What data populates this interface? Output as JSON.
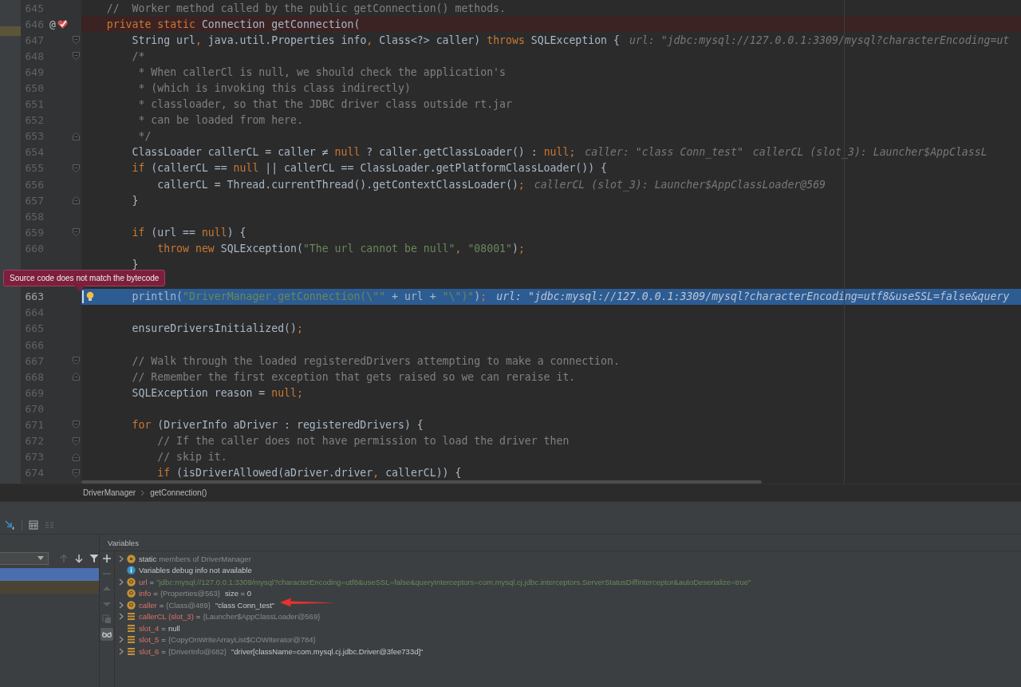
{
  "editor": {
    "lines": [
      {
        "number": "645",
        "kind": "plain",
        "selected": false,
        "breakpoint": false,
        "text": "    //  Worker method called by the public getConnection() methods."
      },
      {
        "number": "646",
        "kind": "plain",
        "selected": false,
        "breakpoint": true,
        "gutter_text": "@",
        "text": "    private static Connection getConnection("
      },
      {
        "number": "647",
        "kind": "fold_start",
        "selected": false,
        "breakpoint": false,
        "text": "        String url, java.util.Properties info, Class<?> caller) throws SQLException {",
        "hints": [
          "url: \"jdbc:mysql://127.0.0.1:3309/mysql?characterEncoding=ut"
        ]
      },
      {
        "number": "648",
        "kind": "fold_start",
        "selected": false,
        "breakpoint": false,
        "text": "        /*"
      },
      {
        "number": "649",
        "kind": "plain",
        "selected": false,
        "breakpoint": false,
        "text": "         * When callerCl is null, we should check the application's"
      },
      {
        "number": "650",
        "kind": "plain",
        "selected": false,
        "breakpoint": false,
        "text": "         * (which is invoking this class indirectly)"
      },
      {
        "number": "651",
        "kind": "plain",
        "selected": false,
        "breakpoint": false,
        "text": "         * classloader, so that the JDBC driver class outside rt.jar"
      },
      {
        "number": "652",
        "kind": "plain",
        "selected": false,
        "breakpoint": false,
        "text": "         * can be loaded from here."
      },
      {
        "number": "653",
        "kind": "fold_end",
        "selected": false,
        "breakpoint": false,
        "text": "         */"
      },
      {
        "number": "654",
        "kind": "plain",
        "selected": false,
        "breakpoint": false,
        "text": "        ClassLoader callerCL = caller ≠ null ? caller.getClassLoader() : null;",
        "hints": [
          "caller: \"class Conn_test\"",
          "callerCL (slot_3): Launcher$AppClassL"
        ]
      },
      {
        "number": "655",
        "kind": "fold_start",
        "selected": false,
        "breakpoint": false,
        "text": "        if (callerCL == null || callerCL == ClassLoader.getPlatformClassLoader()) {"
      },
      {
        "number": "656",
        "kind": "plain",
        "selected": false,
        "breakpoint": false,
        "text": "            callerCL = Thread.currentThread().getContextClassLoader();",
        "hints": [
          "callerCL (slot_3): Launcher$AppClassLoader@569"
        ]
      },
      {
        "number": "657",
        "kind": "fold_end",
        "selected": false,
        "breakpoint": false,
        "text": "        }"
      },
      {
        "number": "658",
        "kind": "plain",
        "selected": false,
        "breakpoint": false
      },
      {
        "number": "659",
        "kind": "fold_start",
        "selected": false,
        "breakpoint": false,
        "text": "        if (url == null) {"
      },
      {
        "number": "660",
        "kind": "plain",
        "selected": false,
        "breakpoint": false,
        "text": "            throw new SQLException(\"The url cannot be null\", \"08001\");"
      },
      {
        "kind": "plain",
        "selected": false,
        "breakpoint": false,
        "text": "        }"
      },
      {
        "kind": "plain",
        "selected": false,
        "breakpoint": false
      },
      {
        "number": "663",
        "kind": "plain",
        "selected": true,
        "breakpoint": false,
        "text": "        println(\"DriverManager.getConnection(\\\"\" + url + \"\\\")\");",
        "hints": [
          "url: \"jdbc:mysql://127.0.0.1:3309/mysql?characterEncoding=utf8&useSSL=false&query"
        ]
      },
      {
        "number": "664",
        "kind": "plain",
        "selected": false,
        "breakpoint": false
      },
      {
        "number": "665",
        "kind": "plain",
        "selected": false,
        "breakpoint": false,
        "text": "        ensureDriversInitialized();"
      },
      {
        "number": "666",
        "kind": "plain",
        "selected": false,
        "breakpoint": false
      },
      {
        "number": "667",
        "kind": "fold_start",
        "selected": false,
        "breakpoint": false,
        "text": "        // Walk through the loaded registeredDrivers attempting to make a connection."
      },
      {
        "number": "668",
        "kind": "fold_end",
        "selected": false,
        "breakpoint": false,
        "text": "        // Remember the first exception that gets raised so we can reraise it."
      },
      {
        "number": "669",
        "kind": "plain",
        "selected": false,
        "breakpoint": false,
        "text": "        SQLException reason = null;"
      },
      {
        "number": "670",
        "kind": "plain",
        "selected": false,
        "breakpoint": false
      },
      {
        "number": "671",
        "kind": "fold_start",
        "selected": false,
        "breakpoint": false,
        "text": "        for (DriverInfo aDriver : registeredDrivers) {"
      },
      {
        "number": "672",
        "kind": "fold_start",
        "selected": false,
        "breakpoint": false,
        "text": "            // If the caller does not have permission to load the driver then"
      },
      {
        "number": "673",
        "kind": "fold_end",
        "selected": false,
        "breakpoint": false,
        "text": "            // skip it."
      },
      {
        "number": "674",
        "kind": "fold_start",
        "selected": false,
        "breakpoint": false,
        "text": "            if (isDriverAllowed(aDriver.driver, callerCL)) {"
      }
    ],
    "tooltip": {
      "text": "Source code does not match the bytecode"
    },
    "breadcrumb": [
      "DriverManager",
      "getConnection()"
    ]
  },
  "debugger": {
    "frame_tools": [
      {
        "kind": "up",
        "disabled": true
      },
      {
        "kind": "down",
        "disabled": false
      },
      {
        "kind": "filter",
        "disabled": false
      }
    ],
    "frames": [
      {
        "selected": true,
        "kind": "frame"
      },
      {
        "selected": false,
        "kind": "library"
      }
    ],
    "variables_title": "Variables",
    "side_tools": [
      {
        "kind": "add",
        "disabled": false,
        "on": false
      },
      {
        "kind": "remove",
        "disabled": true,
        "on": false
      },
      {
        "kind": "up",
        "disabled": true,
        "on": false
      },
      {
        "kind": "down",
        "disabled": true,
        "on": false
      },
      {
        "kind": "copy",
        "disabled": true,
        "on": false
      },
      {
        "kind": "glasses",
        "disabled": false,
        "on": true
      }
    ],
    "variables": [
      {
        "expandable": true,
        "kind": "static",
        "name": "static",
        "type": "members of DriverManager"
      },
      {
        "expandable": false,
        "kind": "info",
        "value": "Variables debug info not available"
      },
      {
        "expandable": true,
        "kind": "param",
        "name": "url",
        "op": "=",
        "string": "\"jdbc:mysql://127.0.0.1:3309/mysql?characterEncoding=utf8&useSSL=false&queryInterceptors=com.mysql.cj.jdbc.interceptors.ServerStatusDiffInterceptor&autoDeserialize=true\""
      },
      {
        "expandable": false,
        "kind": "param",
        "name": "info",
        "op": "=",
        "type": "{Properties@563}",
        "value": "size = 0"
      },
      {
        "expandable": true,
        "kind": "param",
        "name": "caller",
        "op": "=",
        "type": "{Class@489}",
        "value": "\"class Conn_test\""
      },
      {
        "expandable": true,
        "kind": "slot",
        "name": "callerCL (slot_3)",
        "op": "=",
        "type": "{Launcher$AppClassLoader@569}"
      },
      {
        "expandable": false,
        "kind": "slot",
        "name": "slot_4",
        "op": "=",
        "value": "null"
      },
      {
        "expandable": true,
        "kind": "slot",
        "name": "slot_5",
        "op": "=",
        "type": "{CopyOnWriteArrayList$COWIterator@784}"
      },
      {
        "expandable": true,
        "kind": "slot",
        "name": "slot_6",
        "op": "=",
        "type": "{DriverInfo@682}",
        "value": "\"driver[className=com.mysql.cj.jdbc.Driver@3fee733d]\""
      }
    ]
  }
}
